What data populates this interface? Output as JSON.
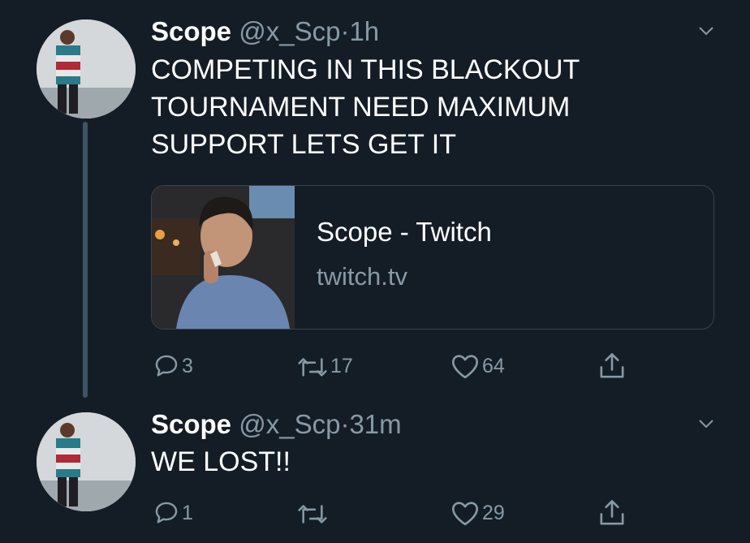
{
  "tweets": [
    {
      "name": "Scope",
      "handle": "@x_Scp",
      "separator": "·",
      "time": "1h",
      "lines": [
        "COMPETING IN THIS BLACKOUT",
        "TOURNAMENT NEED MAXIMUM",
        "SUPPORT LETS GET IT"
      ],
      "card": {
        "title": "Scope - Twitch",
        "domain": "twitch.tv"
      },
      "actions": {
        "replies": "3",
        "retweets": "17",
        "likes": "64"
      }
    },
    {
      "name": "Scope",
      "handle": "@x_Scp",
      "separator": "·",
      "time": "31m",
      "lines": [
        "WE LOST!!"
      ],
      "actions": {
        "replies": "1",
        "retweets": "",
        "likes": "29"
      }
    }
  ],
  "icons": {
    "reply": "speech-bubble-icon",
    "retweet": "retweet-arrows-icon",
    "like": "heart-icon",
    "share": "share-upload-icon",
    "menu": "chevron-down-icon"
  },
  "colors": {
    "background": "#141d26",
    "secondary_text": "#8899a6",
    "thread_line": "#3d5466",
    "card_border": "#38444d"
  }
}
